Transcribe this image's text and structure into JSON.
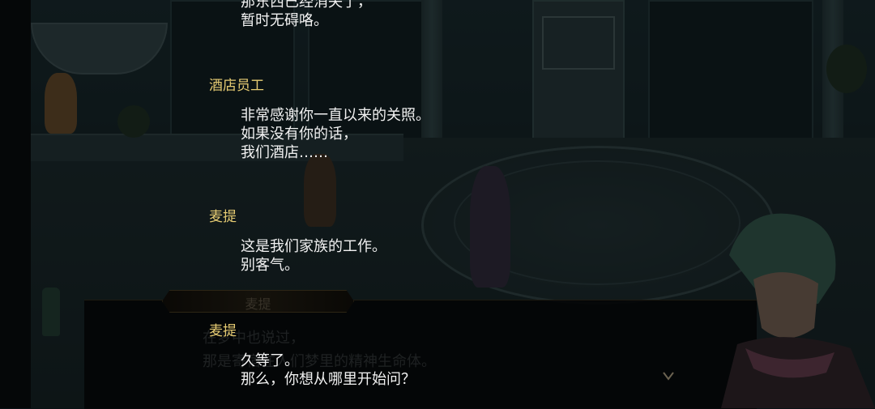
{
  "log": [
    {
      "speaker": "",
      "lines": [
        "那东西已经消失了，",
        "暂时无碍咯。"
      ]
    },
    {
      "speaker": "酒店员工",
      "lines": [
        "非常感谢你一直以来的关照。",
        "如果没有你的话，",
        "我们酒店……"
      ]
    },
    {
      "speaker": "麦提",
      "lines": [
        "这是我们家族的工作。",
        "别客气。"
      ]
    },
    {
      "speaker": "麦提",
      "lines": [
        "久等了。",
        "那么，你想从哪里开始问？"
      ]
    }
  ],
  "dialog": {
    "name": "麦提",
    "text_line1": "在梦中也说过，",
    "text_line2": "那是寄宿在人们梦里的精神生命体。"
  },
  "icons": {
    "next": "chevron-down-icon"
  },
  "colors": {
    "speaker": "#e7cc73",
    "text": "#f2f2f2"
  }
}
